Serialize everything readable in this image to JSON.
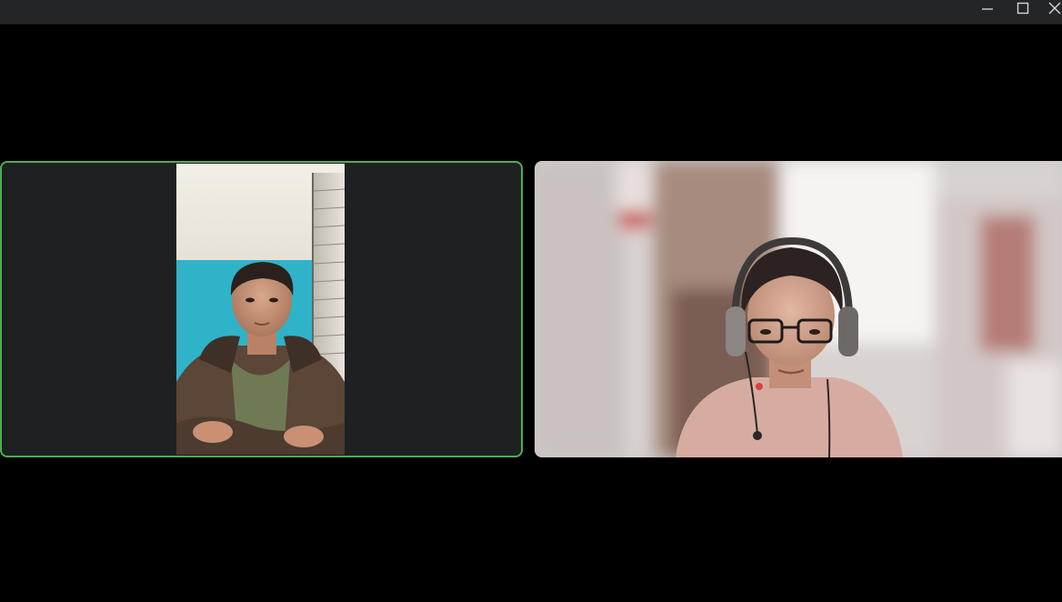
{
  "window": {
    "controls": {
      "minimize": "minimize",
      "maximize": "maximize",
      "close": "close"
    }
  },
  "meeting": {
    "layout": "gallery",
    "participants": [
      {
        "id": "participant-1",
        "active_speaker": true,
        "video": "on"
      },
      {
        "id": "participant-2",
        "active_speaker": false,
        "video": "on"
      }
    ],
    "colors": {
      "active_speaker_border": "#4caf50",
      "tile_background": "#1f2022",
      "stage_background": "#000000",
      "titlebar_background": "#242527"
    }
  }
}
